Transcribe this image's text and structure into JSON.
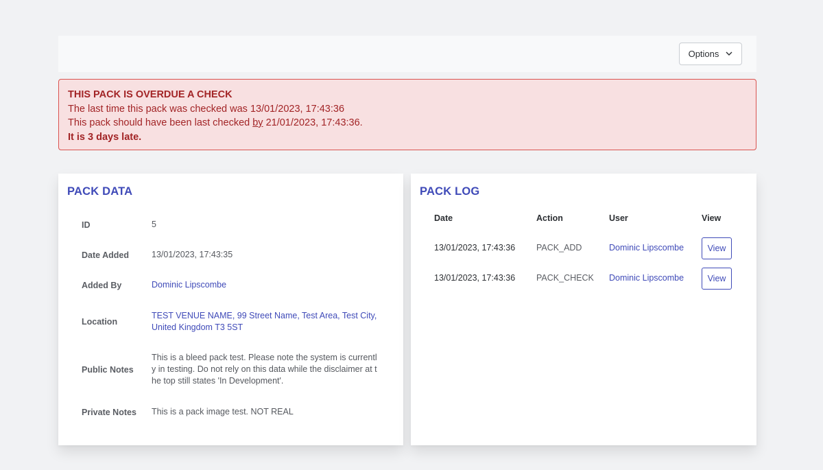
{
  "toolbar": {
    "options_label": "Options"
  },
  "alert": {
    "title": "THIS PACK IS OVERDUE A CHECK",
    "line1": "The last time this pack was checked was 13/01/2023, 17:43:36",
    "line2_pre": "This pack should have been last checked ",
    "line2_by": "by",
    "line2_post": " 21/01/2023, 17:43:36.",
    "line3": "It is 3 days late."
  },
  "pack_data": {
    "title": "PACK DATA",
    "rows": [
      {
        "key": "ID",
        "value": "5"
      },
      {
        "key": "Date Added",
        "value": "13/01/2023, 17:43:35"
      },
      {
        "key": "Added By",
        "value": "Dominic Lipscombe"
      },
      {
        "key": "Location",
        "value": "TEST VENUE NAME, 99 Street Name, Test Area, Test City, United Kingdom T3 5ST"
      },
      {
        "key": "Public Notes",
        "value": "This is a bleed pack test. Please note the system is currently in testing. Do not rely on this data while the disclaimer at the top still states 'In Development'."
      },
      {
        "key": "Private Notes",
        "value": "This is a pack image test. NOT REAL"
      }
    ]
  },
  "pack_log": {
    "title": "PACK LOG",
    "columns": [
      "Date",
      "Action",
      "User",
      "View"
    ],
    "rows": [
      {
        "date": "13/01/2023, 17:43:36",
        "action": "PACK_ADD",
        "user": "Dominic Lipscombe",
        "view": "View"
      },
      {
        "date": "13/01/2023, 17:43:36",
        "action": "PACK_CHECK",
        "user": "Dominic Lipscombe",
        "view": "View"
      }
    ]
  },
  "colors": {
    "accent": "#3f4ab8",
    "danger_text": "#a22426",
    "danger_bg": "#f8e0e1",
    "danger_border": "#d9534f"
  }
}
